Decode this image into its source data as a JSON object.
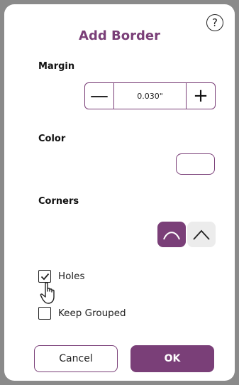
{
  "dialog": {
    "title": "Add Border",
    "help_icon": "question-circle-icon",
    "help_label": "?"
  },
  "margin": {
    "label": "Margin",
    "value": "0.030\"",
    "minus_label": "—",
    "plus_label": "+"
  },
  "color": {
    "label": "Color",
    "swatch_color": "#ffffff"
  },
  "corners": {
    "label": "Corners",
    "options": [
      "rounded",
      "square"
    ],
    "selected": "rounded"
  },
  "options": {
    "holes": {
      "label": "Holes",
      "checked": true
    },
    "keep_grouped": {
      "label": "Keep Grouped",
      "checked": false
    }
  },
  "buttons": {
    "cancel": "Cancel",
    "ok": "OK"
  },
  "colors": {
    "accent": "#7a3f78",
    "backdrop": "#8a8a8a",
    "inactive": "#ececec"
  }
}
